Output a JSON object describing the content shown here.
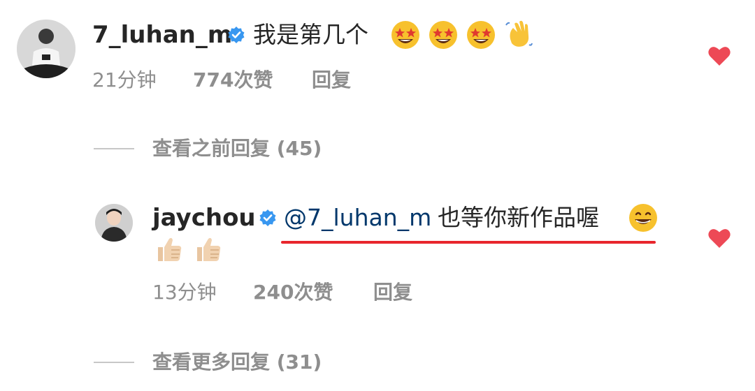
{
  "comment1": {
    "username": "7_luhan_m",
    "text": "我是第几个",
    "emojis": [
      "star-struck-emoji",
      "star-struck-emoji",
      "star-struck-emoji",
      "waving-hand-emoji"
    ],
    "time": "21分钟",
    "likes": "774次赞",
    "reply": "回复",
    "liked": true
  },
  "view_previous": "查看之前回复 (45)",
  "comment2": {
    "username": "jaychou",
    "mention": "@7_luhan_m",
    "text": "也等你新作品喔",
    "emojis": [
      "grinning-face-emoji",
      "thumbs-up-emoji",
      "thumbs-up-emoji"
    ],
    "time": "13分钟",
    "likes": "240次赞",
    "reply": "回复",
    "liked": true
  },
  "view_more": "查看更多回复 (31)",
  "colors": {
    "heart": "#ed4956",
    "verified": "#3897f0",
    "mention": "#00376b",
    "underline": "#e8262d",
    "secondary_text": "#8e8e8e"
  }
}
